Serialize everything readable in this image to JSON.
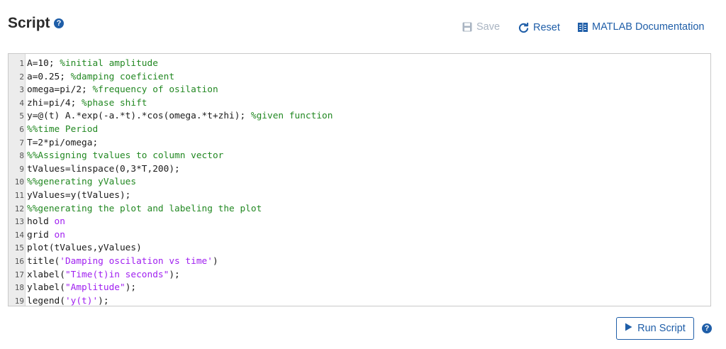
{
  "header": {
    "title": "Script",
    "help_glyph": "?",
    "save_label": "Save",
    "reset_label": "Reset",
    "docs_label": "MATLAB Documentation"
  },
  "colors": {
    "accent": "#1f5ea8",
    "disabled": "#a9b4c2",
    "comment": "#228822",
    "string": "#a020f0",
    "keyword": "#a020f0"
  },
  "editor": {
    "lines": [
      {
        "num": "1",
        "parts": [
          {
            "t": "A=10; "
          },
          {
            "t": "%initial amplitude",
            "c": "c"
          }
        ]
      },
      {
        "num": "2",
        "parts": [
          {
            "t": "a=0.25; "
          },
          {
            "t": "%damping coeficient",
            "c": "c"
          }
        ]
      },
      {
        "num": "3",
        "parts": [
          {
            "t": "omega=pi/2; "
          },
          {
            "t": "%frequency of osilation",
            "c": "c"
          }
        ]
      },
      {
        "num": "4",
        "parts": [
          {
            "t": "zhi=pi/4; "
          },
          {
            "t": "%phase shift",
            "c": "c"
          }
        ]
      },
      {
        "num": "5",
        "parts": [
          {
            "t": "y=@(t) A.*exp(-a.*t).*cos(omega.*t+zhi); "
          },
          {
            "t": "%given function",
            "c": "c"
          }
        ]
      },
      {
        "num": "6",
        "parts": [
          {
            "t": "%%time Period",
            "c": "c"
          }
        ]
      },
      {
        "num": "7",
        "parts": [
          {
            "t": "T=2*pi/omega;"
          }
        ]
      },
      {
        "num": "8",
        "parts": [
          {
            "t": "%%Assigning tvalues to column vector",
            "c": "c"
          }
        ]
      },
      {
        "num": "9",
        "parts": [
          {
            "t": "tValues=linspace(0,3*T,200);"
          }
        ]
      },
      {
        "num": "10",
        "parts": [
          {
            "t": "%%generating yValues",
            "c": "c"
          }
        ]
      },
      {
        "num": "11",
        "parts": [
          {
            "t": "yValues=y(tValues);"
          }
        ]
      },
      {
        "num": "12",
        "parts": [
          {
            "t": "%%generating the plot and labeling the plot",
            "c": "c"
          }
        ]
      },
      {
        "num": "13",
        "parts": [
          {
            "t": "hold "
          },
          {
            "t": "on",
            "c": "k"
          }
        ]
      },
      {
        "num": "14",
        "parts": [
          {
            "t": "grid "
          },
          {
            "t": "on",
            "c": "k"
          }
        ]
      },
      {
        "num": "15",
        "parts": [
          {
            "t": "plot(tValues,yValues)"
          }
        ]
      },
      {
        "num": "16",
        "parts": [
          {
            "t": "title("
          },
          {
            "t": "'Damping oscilation vs time'",
            "c": "s"
          },
          {
            "t": ")"
          }
        ]
      },
      {
        "num": "17",
        "parts": [
          {
            "t": "xlabel("
          },
          {
            "t": "\"Time(t)in seconds\"",
            "c": "s"
          },
          {
            "t": ");"
          }
        ]
      },
      {
        "num": "18",
        "parts": [
          {
            "t": "ylabel("
          },
          {
            "t": "\"Amplitude\"",
            "c": "s"
          },
          {
            "t": ");"
          }
        ]
      },
      {
        "num": "19",
        "parts": [
          {
            "t": "legend("
          },
          {
            "t": "'y(t)'",
            "c": "s"
          },
          {
            "t": ");"
          }
        ]
      }
    ]
  },
  "footer": {
    "run_label": "Run Script",
    "help_glyph": "?"
  }
}
